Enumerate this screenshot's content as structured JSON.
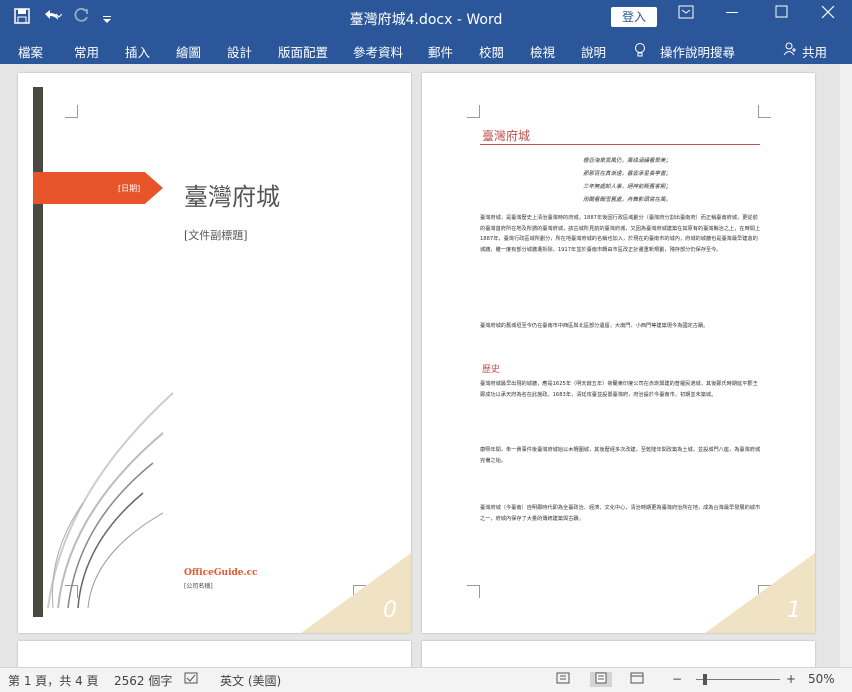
{
  "titlebar": {
    "doc_title": "臺灣府城4.docx - Word",
    "login": "登入",
    "qat_icons": [
      "save-icon",
      "undo-icon",
      "redo-icon",
      "customize-qat-icon"
    ]
  },
  "ribbon": {
    "tabs": [
      "檔案",
      "常用",
      "插入",
      "繪圖",
      "設計",
      "版面配置",
      "參考資料",
      "郵件",
      "校閱",
      "檢視",
      "說明"
    ],
    "tell_me": "操作說明搜尋",
    "share": "共用"
  },
  "page1": {
    "date_label": "[日期]",
    "title": "臺灣府城",
    "subtitle": "[文件副標題]",
    "company": "OfficeGuide.cc",
    "company_name": "[公司名稱]",
    "page_number": "0"
  },
  "page2": {
    "heading": "臺灣府城",
    "poem": [
      "檐亞海東異風仍，萬綠涵繡看翠美；",
      "那那百在真漸遠，暮雲承星奏亭晝；",
      "三年無處卸人事，絕神前殿舊客殿；",
      "雨閣看聞雪舊處，舟舞影頭寫在萬。"
    ],
    "p1": "臺灣府城，是臺灣歷史上清治臺灣時的府城，1887年後因行政區域劃分（臺灣府分割出臺南府）而正稱臺南府城，更從前的臺灣首府所在地及所謂的臺灣府城，該古城所見前的臺灣府城，又因為臺灣府城建築在其原有的臺灣縣治之上，在時間上1887年，臺灣行政區域所劃分，所在地臺灣府城的名稱也加入，於現在的臺南市的城內，府城的城牆也是臺灣最早建造的城牆，雖一度有部分城牆遭拆除，1917年並於臺南市轉由市區改正計畫重新規劃，殘存部分仍保存至今。",
    "p2": "臺灣府城的舊城垣至今仍在臺南市中西區與北區部分遺留，大南門、小西門等建築現今為國定古蹟。",
    "heading2": "歷史",
    "p3": "臺灣府城最早出現的城牆，應是1625年（明天啟五年）荷蘭東印度公司在赤崁興建的普羅民遮城，其後鄭氏時期延平郡王鄭成功以承天府為名在此施政。1683年，清廷攻臺並設置臺灣府，府治設於今臺南市，初期並未築城。",
    "p4": "康熙年間，朱一貴事件後臺灣府城始以木柵圍城，其後歷經多次改建，至乾隆年間改築為土城，並設城門八座，為臺灣府城完備之始。",
    "p5": "臺灣府城（今臺南）自明鄭時代即為全臺政治、經濟、文化中心，清治時期更為臺灣府治所在地，成為台灣最早發展的城市之一，府城內保存了大量的傳統建築與古蹟。",
    "page_number": "1"
  },
  "statusbar": {
    "page_info": "第 1 頁，共 4 頁",
    "word_count": "2562 個字",
    "language": "英文 (美國)",
    "zoom": "50%",
    "zoom_minus": "−",
    "zoom_plus": "+"
  },
  "colors": {
    "ribbon_blue": "#2b579a",
    "accent_orange": "#e8542a",
    "heading_red": "#c0504d"
  }
}
